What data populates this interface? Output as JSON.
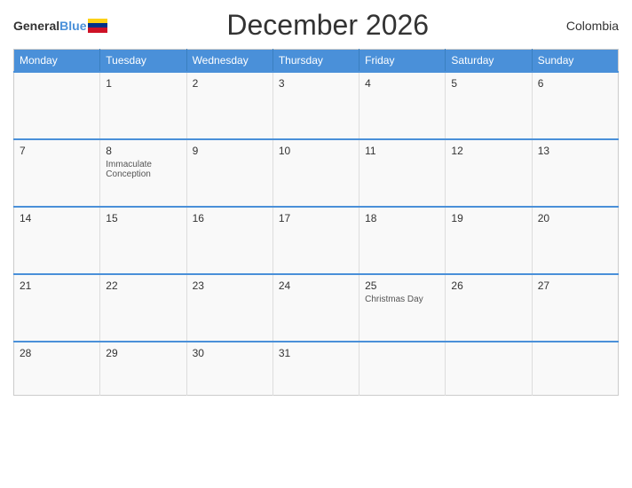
{
  "header": {
    "logo_general": "General",
    "logo_blue": "Blue",
    "title": "December 2026",
    "country": "Colombia"
  },
  "days_of_week": [
    "Monday",
    "Tuesday",
    "Wednesday",
    "Thursday",
    "Friday",
    "Saturday",
    "Sunday"
  ],
  "weeks": [
    [
      {
        "day": "",
        "holiday": ""
      },
      {
        "day": "1",
        "holiday": ""
      },
      {
        "day": "2",
        "holiday": ""
      },
      {
        "day": "3",
        "holiday": ""
      },
      {
        "day": "4",
        "holiday": ""
      },
      {
        "day": "5",
        "holiday": ""
      },
      {
        "day": "6",
        "holiday": ""
      }
    ],
    [
      {
        "day": "7",
        "holiday": ""
      },
      {
        "day": "8",
        "holiday": "Immaculate Conception"
      },
      {
        "day": "9",
        "holiday": ""
      },
      {
        "day": "10",
        "holiday": ""
      },
      {
        "day": "11",
        "holiday": ""
      },
      {
        "day": "12",
        "holiday": ""
      },
      {
        "day": "13",
        "holiday": ""
      }
    ],
    [
      {
        "day": "14",
        "holiday": ""
      },
      {
        "day": "15",
        "holiday": ""
      },
      {
        "day": "16",
        "holiday": ""
      },
      {
        "day": "17",
        "holiday": ""
      },
      {
        "day": "18",
        "holiday": ""
      },
      {
        "day": "19",
        "holiday": ""
      },
      {
        "day": "20",
        "holiday": ""
      }
    ],
    [
      {
        "day": "21",
        "holiday": ""
      },
      {
        "day": "22",
        "holiday": ""
      },
      {
        "day": "23",
        "holiday": ""
      },
      {
        "day": "24",
        "holiday": ""
      },
      {
        "day": "25",
        "holiday": "Christmas Day"
      },
      {
        "day": "26",
        "holiday": ""
      },
      {
        "day": "27",
        "holiday": ""
      }
    ],
    [
      {
        "day": "28",
        "holiday": ""
      },
      {
        "day": "29",
        "holiday": ""
      },
      {
        "day": "30",
        "holiday": ""
      },
      {
        "day": "31",
        "holiday": ""
      },
      {
        "day": "",
        "holiday": ""
      },
      {
        "day": "",
        "holiday": ""
      },
      {
        "day": "",
        "holiday": ""
      }
    ]
  ]
}
